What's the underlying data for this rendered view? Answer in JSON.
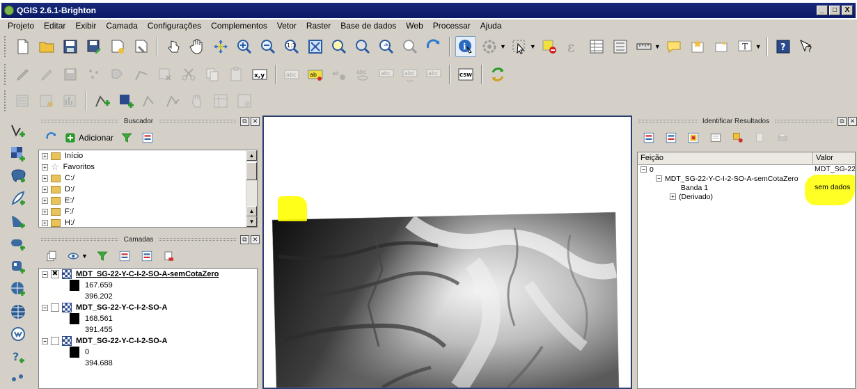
{
  "window": {
    "title": "QGIS 2.6.1-Brighton",
    "controls": [
      "_",
      "□",
      "X"
    ]
  },
  "menu": [
    "Projeto",
    "Editar",
    "Exibir",
    "Camada",
    "Configurações",
    "Complementos",
    "Vetor",
    "Raster",
    "Base de dados",
    "Web",
    "Processar",
    "Ajuda"
  ],
  "browser": {
    "title": "Buscador",
    "add_label": "Adicionar",
    "items": [
      {
        "label": "Início"
      },
      {
        "label": "Favoritos"
      },
      {
        "label": "C:/"
      },
      {
        "label": "D:/"
      },
      {
        "label": "E:/"
      },
      {
        "label": "F:/"
      },
      {
        "label": "H:/"
      }
    ]
  },
  "layers_panel": {
    "title": "Camadas",
    "layers": [
      {
        "name": "MDT_SG-22-Y-C-I-2-SO-A-semCotaZero",
        "checked": true,
        "max": "167.659",
        "min": "396.202"
      },
      {
        "name": "MDT_SG-22-Y-C-I-2-SO-A",
        "checked": false,
        "max": "168.561",
        "min": "391.455"
      },
      {
        "name": "MDT_SG-22-Y-C-I-2-SO-A",
        "checked": false,
        "max": "0",
        "min": "394.688"
      }
    ]
  },
  "identify": {
    "title": "Identificar Resultados",
    "col_feature": "Feição",
    "col_value": "Valor",
    "rows": [
      {
        "feature": "0",
        "value": "MDT_SG-22"
      },
      {
        "feature": "MDT_SG-22-Y-C-I-2-SO-A-semCotaZero",
        "value": ""
      },
      {
        "feature": "Banda 1",
        "value": "sem dados"
      },
      {
        "feature": "(Derivado)",
        "value": ""
      }
    ]
  },
  "colors": {
    "highlight": "#ffff00",
    "title_bar": "#0a1a66",
    "map_border": "#2a3f6f"
  }
}
